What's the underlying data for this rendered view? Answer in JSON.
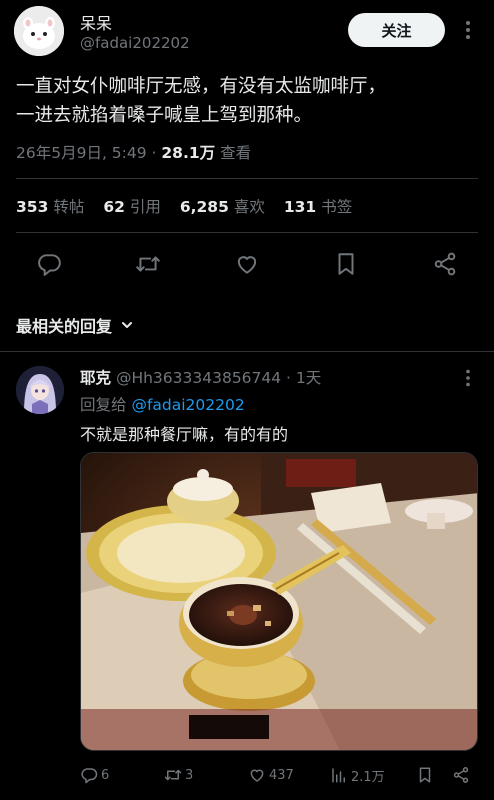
{
  "post": {
    "author_name": "呆呆",
    "author_handle": "@fadai202202",
    "follow_label": "关注",
    "text_line1": "一直对女仆咖啡厅无感，有没有太监咖啡厅，",
    "text_line2": "一进去就掐着嗓子喊皇上驾到那种。",
    "date": "26年5月9日, 5:49 · ",
    "views": "28.1万",
    "views_label": " 查看"
  },
  "stats": {
    "reposts_count": "353",
    "reposts_label": "转帖",
    "quotes_count": "62",
    "quotes_label": "引用",
    "likes_count": "6,285",
    "likes_label": "喜欢",
    "bookmarks_count": "131",
    "bookmarks_label": "书签"
  },
  "sort": {
    "label": "最相关的回复"
  },
  "reply": {
    "name": "耶克",
    "handle": "@Hh3633343856744 · 1天",
    "reply_to_prefix": "回复给 ",
    "reply_to_handle": "@fadai202202",
    "text": "不就是那种餐厅嘛，有的有的",
    "replies": "6",
    "reposts": "3",
    "likes": "437",
    "views": "2.1万"
  },
  "colors": {
    "background": "#000000",
    "text_primary": "#e7e9ea",
    "text_secondary": "#71767b",
    "link": "#1d9bf0",
    "divider": "#2f3336",
    "follow_button": "#eff3f4"
  },
  "icons": [
    "more-dots-icon",
    "reply-icon",
    "repost-icon",
    "like-icon",
    "bookmark-icon",
    "share-icon",
    "chevron-down-icon",
    "views-icon"
  ]
}
